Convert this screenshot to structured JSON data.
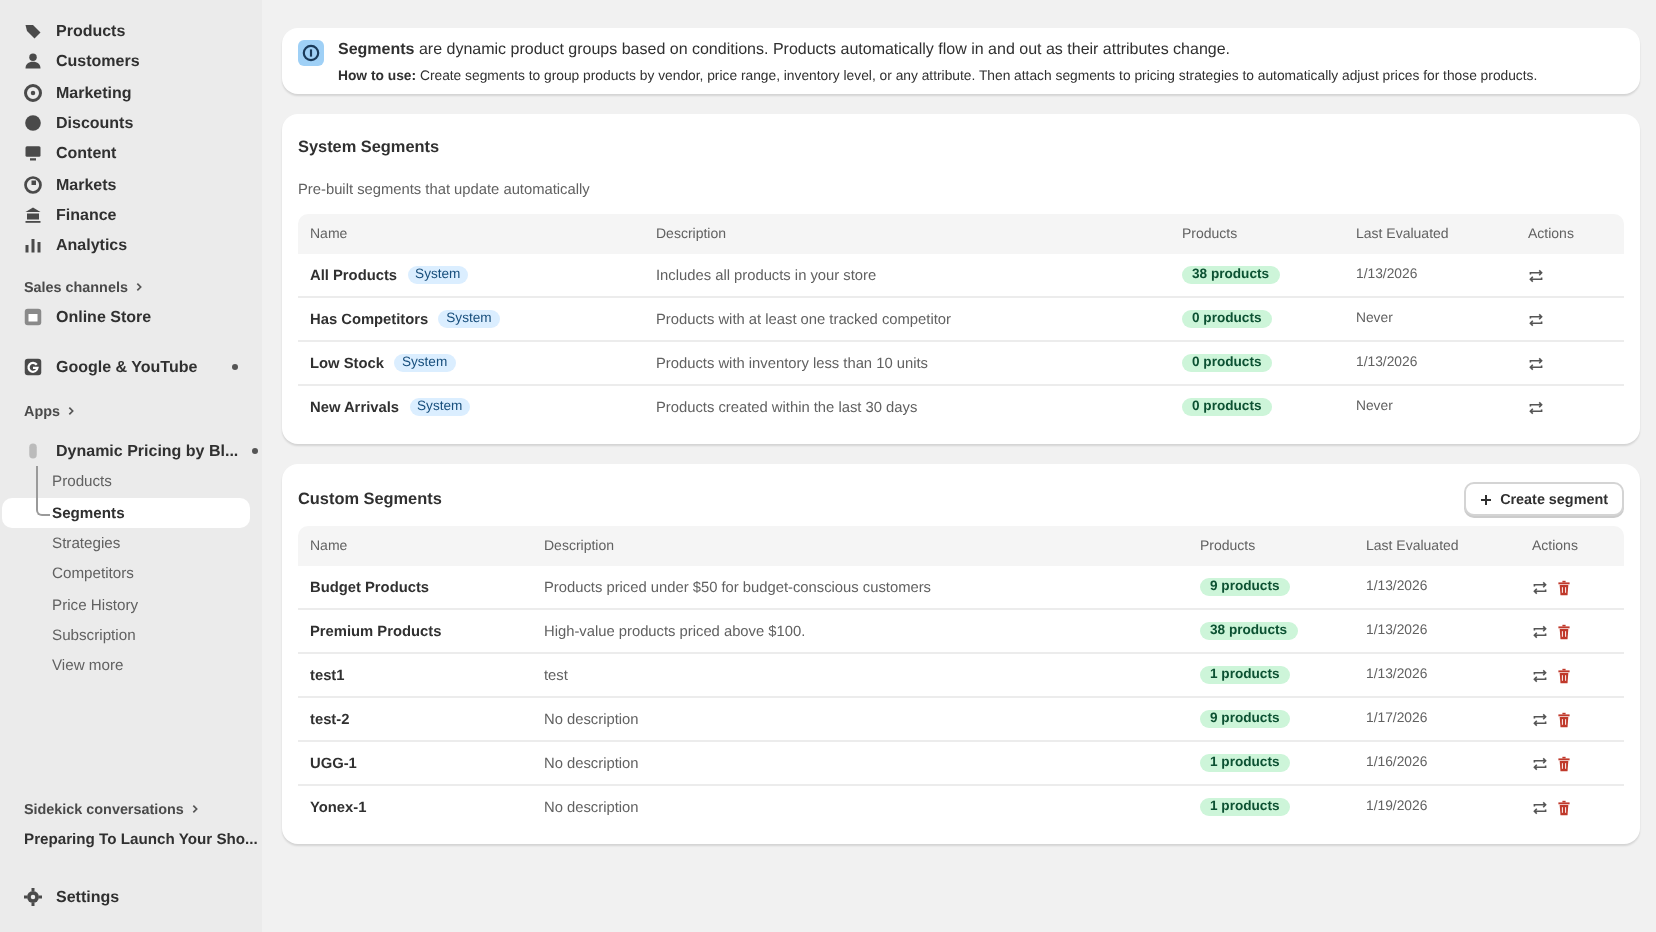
{
  "sidebar": {
    "nav": [
      {
        "label": "Products"
      },
      {
        "label": "Customers"
      },
      {
        "label": "Marketing"
      },
      {
        "label": "Discounts"
      },
      {
        "label": "Content"
      },
      {
        "label": "Markets"
      },
      {
        "label": "Finance"
      },
      {
        "label": "Analytics"
      }
    ],
    "sales_channels": {
      "heading": "Sales channels",
      "items": [
        {
          "label": "Online Store",
          "expanded": false
        },
        {
          "label": "Google & YouTube",
          "expanded": true
        }
      ]
    },
    "apps": {
      "heading": "Apps",
      "app": {
        "label": "Dynamic Pricing by Bl...",
        "expanded": true
      },
      "items": [
        {
          "label": "Products",
          "selected": false
        },
        {
          "label": "Segments",
          "selected": true
        },
        {
          "label": "Strategies",
          "selected": false
        },
        {
          "label": "Competitors",
          "selected": false
        },
        {
          "label": "Price History",
          "selected": false
        },
        {
          "label": "Subscription",
          "selected": false
        },
        {
          "label": "View more",
          "selected": false
        }
      ]
    },
    "sidekick": {
      "heading": "Sidekick conversations",
      "items": [
        "Preparing To Launch Your Sho..."
      ]
    },
    "settings": "Settings"
  },
  "banner": {
    "line_1": "**Segments** are dynamic product groups based on conditions. Products automatically flow in and out as their attributes change.",
    "line_2": "**How to use:** Create segments to group products by vendor, price range, inventory level, or any attribute. Then attach segments to pricing strategies to automatically adjust prices for those products."
  },
  "cards": [
    {
      "kind": "system",
      "title": "System Segments",
      "subtitle": "Pre-built segments that update automatically",
      "columns": [
        "Name",
        "Description",
        "Products",
        "Last Evaluated",
        "Actions"
      ],
      "rows": [
        {
          "name": "All Products",
          "badge": "System",
          "description": "Includes all products in your store",
          "products": "38 products",
          "last_evaluated": "1/13/2026"
        },
        {
          "name": "Has Competitors",
          "badge": "System",
          "description": "Products with at least one tracked competitor",
          "products": "0 products",
          "last_evaluated": "Never"
        },
        {
          "name": "Low Stock",
          "badge": "System",
          "description": "Products with inventory less than 10 units",
          "products": "0 products",
          "last_evaluated": "1/13/2026"
        },
        {
          "name": "New Arrivals",
          "badge": "System",
          "description": "Products created within the last 30 days",
          "products": "0 products",
          "last_evaluated": "Never"
        }
      ]
    },
    {
      "kind": "custom",
      "title": "Custom Segments",
      "button": "Create segment",
      "columns": [
        "Name",
        "Description",
        "Products",
        "Last Evaluated",
        "Actions"
      ],
      "rows": [
        {
          "name": "Budget Products",
          "description": "Products priced under $50 for budget-conscious customers",
          "products": "9 products",
          "last_evaluated": "1/13/2026"
        },
        {
          "name": "Premium Products",
          "description": "High-value products priced above $100.",
          "products": "38 products",
          "last_evaluated": "1/13/2026"
        },
        {
          "name": "test1",
          "description": "test",
          "products": "1 products",
          "last_evaluated": "1/13/2026"
        },
        {
          "name": "test-2",
          "description": "No description",
          "products": "9 products",
          "last_evaluated": "1/17/2026"
        },
        {
          "name": "UGG-1",
          "description": "No description",
          "products": "1 products",
          "last_evaluated": "1/16/2026"
        },
        {
          "name": "Yonex-1",
          "description": "No description",
          "products": "1 products",
          "last_evaluated": "1/19/2026"
        }
      ]
    }
  ]
}
